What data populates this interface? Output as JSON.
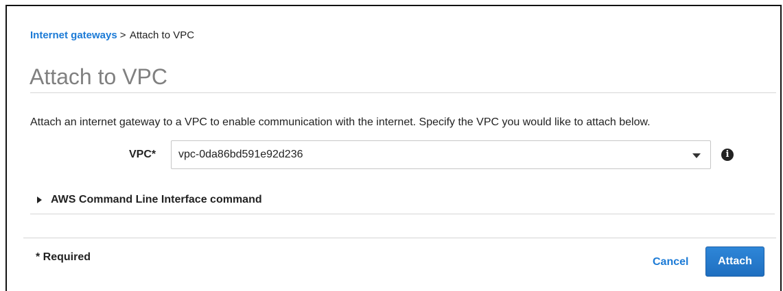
{
  "breadcrumb": {
    "parent_link": "Internet gateways",
    "separator": ">",
    "current": "Attach to VPC"
  },
  "page_title": "Attach to VPC",
  "description": "Attach an internet gateway to a VPC to enable communication with the internet. Specify the VPC you would like to attach below.",
  "vpc_field": {
    "label": "VPC*",
    "selected_value": "vpc-0da86bd591e92d236",
    "caret_icon": "caret-down-icon",
    "info_icon": "info-icon"
  },
  "cli_section": {
    "label": "AWS Command Line Interface command",
    "expand_icon": "triangle-right-icon"
  },
  "footer": {
    "required_note": "* Required",
    "cancel_label": "Cancel",
    "attach_label": "Attach"
  },
  "colors": {
    "link": "#1b7ad6",
    "primary_button": "#1f6fc0",
    "title": "#808080",
    "text": "#222222"
  }
}
